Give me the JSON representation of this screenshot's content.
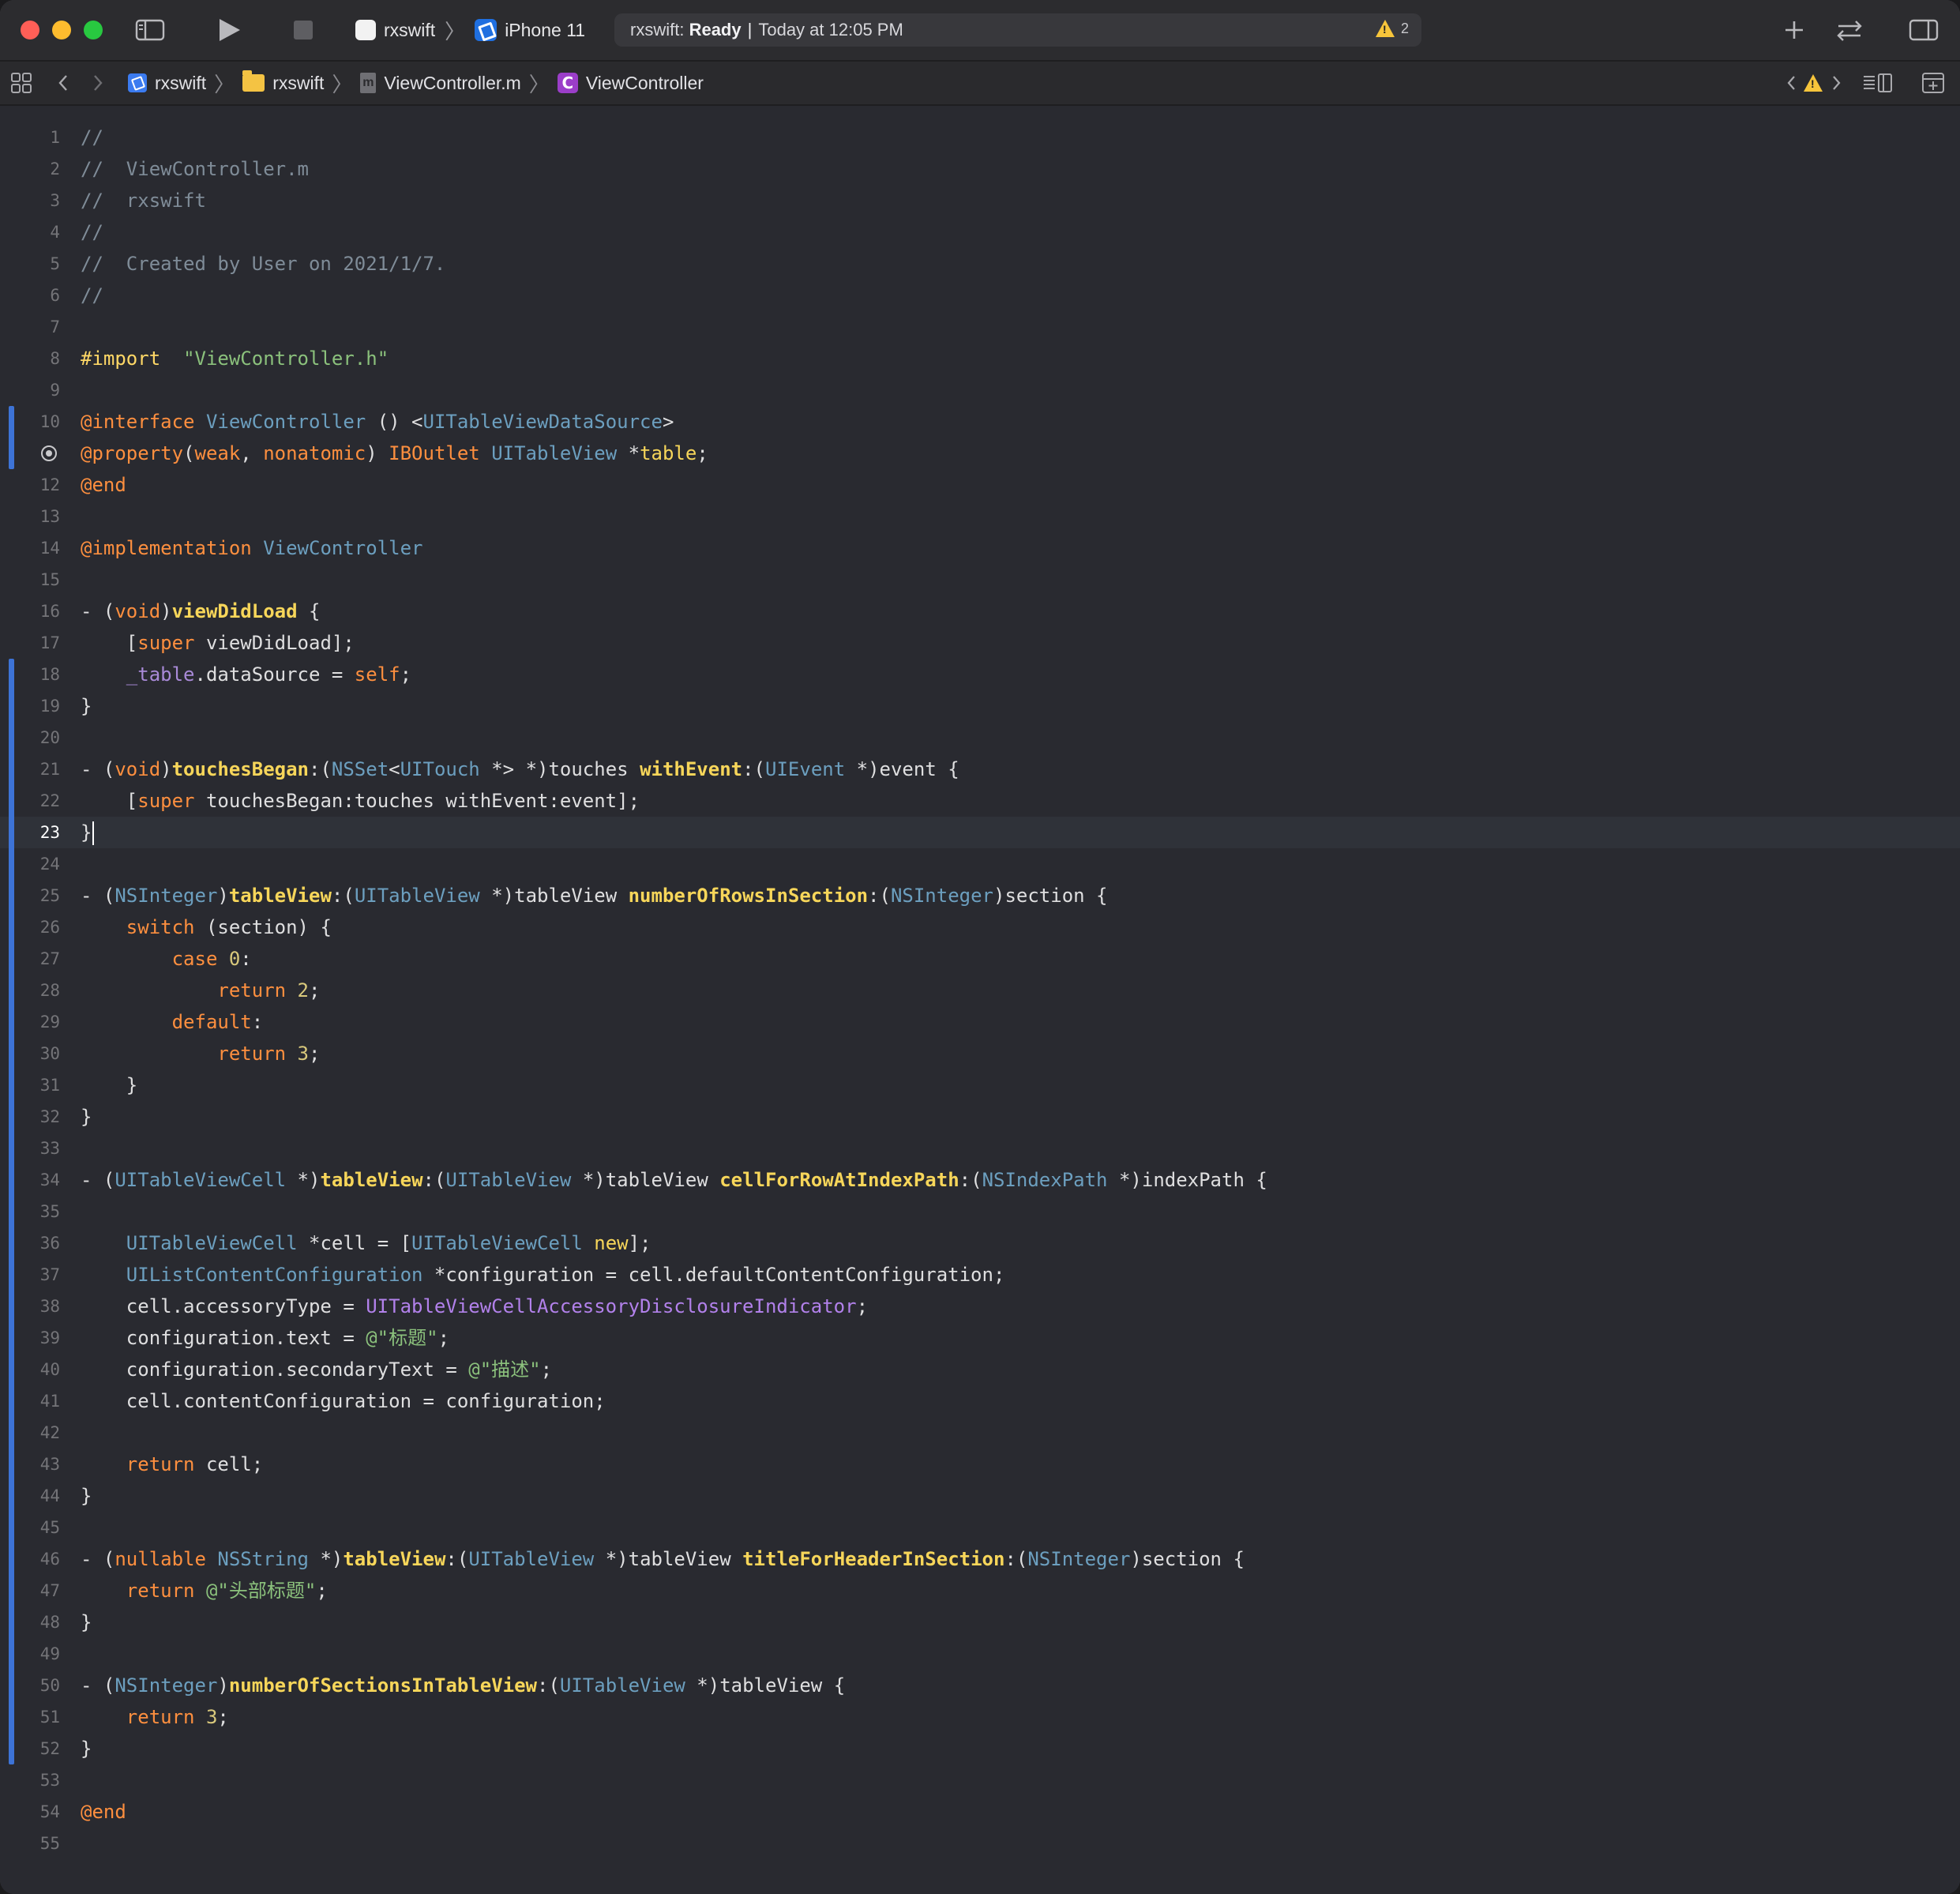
{
  "titlebar": {
    "scheme_project": "rxswift",
    "scheme_device": "iPhone 11",
    "activity_project": "rxswift:",
    "activity_status": "Ready",
    "activity_sep": "|",
    "activity_time": "Today at 12:05 PM",
    "warning_count": "2"
  },
  "jumpbar": {
    "project": "rxswift",
    "group": "rxswift",
    "file": "ViewController.m",
    "symbol": "ViewController"
  },
  "editor": {
    "current_line": 23,
    "changed_ranges": [
      [
        10,
        11
      ],
      [
        18,
        52
      ]
    ],
    "outlet_line": 11,
    "lines": [
      [
        [
          "cm",
          "//"
        ]
      ],
      [
        [
          "cm",
          "//  ViewController.m"
        ]
      ],
      [
        [
          "cm",
          "//  rxswift"
        ]
      ],
      [
        [
          "cm",
          "//"
        ]
      ],
      [
        [
          "cm",
          "//  Created by User on 2021/1/7."
        ]
      ],
      [
        [
          "cm",
          "//"
        ]
      ],
      [],
      [
        [
          "imp",
          "#import"
        ],
        [
          "",
          "  "
        ],
        [
          "str",
          "\"ViewController.h\""
        ]
      ],
      [],
      [
        [
          "ak",
          "@interface"
        ],
        [
          "",
          " "
        ],
        [
          "ty",
          "ViewController"
        ],
        [
          "",
          " () <"
        ],
        [
          "ty",
          "UITableViewDataSource"
        ],
        [
          "",
          ">"
        ]
      ],
      [
        [
          "ak",
          "@property"
        ],
        [
          "",
          "("
        ],
        [
          "ak",
          "weak"
        ],
        [
          "",
          ", "
        ],
        [
          "ak",
          "nonatomic"
        ],
        [
          "",
          ") "
        ],
        [
          "ak",
          "IBOutlet"
        ],
        [
          "",
          " "
        ],
        [
          "ty",
          "UITableView"
        ],
        [
          "",
          " *"
        ],
        [
          "fnd",
          "table"
        ],
        [
          "",
          ";"
        ]
      ],
      [
        [
          "ak",
          "@end"
        ]
      ],
      [],
      [
        [
          "ak",
          "@implementation"
        ],
        [
          "",
          " "
        ],
        [
          "ty",
          "ViewController"
        ]
      ],
      [],
      [
        [
          "",
          "- ("
        ],
        [
          "ak",
          "void"
        ],
        [
          "",
          ")"
        ],
        [
          "fn",
          "viewDidLoad"
        ],
        [
          "",
          " {"
        ]
      ],
      [
        [
          "",
          "    ["
        ],
        [
          "ak",
          "super"
        ],
        [
          "",
          " viewDidLoad];"
        ]
      ],
      [
        [
          "",
          "    "
        ],
        [
          "iv",
          "_table"
        ],
        [
          "",
          ".dataSource = "
        ],
        [
          "ak",
          "self"
        ],
        [
          "",
          ";"
        ]
      ],
      [
        [
          "",
          "}"
        ]
      ],
      [],
      [
        [
          "",
          "- ("
        ],
        [
          "ak",
          "void"
        ],
        [
          "",
          ")"
        ],
        [
          "fn",
          "touchesBegan"
        ],
        [
          "",
          ":("
        ],
        [
          "ty",
          "NSSet"
        ],
        [
          "",
          "<"
        ],
        [
          "ty",
          "UITouch"
        ],
        [
          "",
          " *> *)touches "
        ],
        [
          "fn",
          "withEvent"
        ],
        [
          "",
          ":("
        ],
        [
          "ty",
          "UIEvent"
        ],
        [
          "",
          " *)event {"
        ]
      ],
      [
        [
          "",
          "    ["
        ],
        [
          "ak",
          "super"
        ],
        [
          "",
          " touchesBegan:touches withEvent:event];"
        ]
      ],
      [
        [
          "",
          "}"
        ]
      ],
      [],
      [
        [
          "",
          "- ("
        ],
        [
          "ty",
          "NSInteger"
        ],
        [
          "",
          ")"
        ],
        [
          "fn",
          "tableView"
        ],
        [
          "",
          ":("
        ],
        [
          "ty",
          "UITableView"
        ],
        [
          "",
          " *)tableView "
        ],
        [
          "fn",
          "numberOfRowsInSection"
        ],
        [
          "",
          ":("
        ],
        [
          "ty",
          "NSInteger"
        ],
        [
          "",
          ")section {"
        ]
      ],
      [
        [
          "",
          "    "
        ],
        [
          "ak",
          "switch"
        ],
        [
          "",
          " (section) {"
        ]
      ],
      [
        [
          "",
          "        "
        ],
        [
          "ak",
          "case"
        ],
        [
          "",
          " "
        ],
        [
          "num",
          "0"
        ],
        [
          "",
          ":"
        ]
      ],
      [
        [
          "",
          "            "
        ],
        [
          "ak",
          "return"
        ],
        [
          "",
          " "
        ],
        [
          "num",
          "2"
        ],
        [
          "",
          ";"
        ]
      ],
      [
        [
          "",
          "        "
        ],
        [
          "ak",
          "default"
        ],
        [
          "",
          ":"
        ]
      ],
      [
        [
          "",
          "            "
        ],
        [
          "ak",
          "return"
        ],
        [
          "",
          " "
        ],
        [
          "num",
          "3"
        ],
        [
          "",
          ";"
        ]
      ],
      [
        [
          "",
          "    }"
        ]
      ],
      [
        [
          "",
          "}"
        ]
      ],
      [],
      [
        [
          "",
          "- ("
        ],
        [
          "ty",
          "UITableViewCell"
        ],
        [
          "",
          " *)"
        ],
        [
          "fn",
          "tableView"
        ],
        [
          "",
          ":("
        ],
        [
          "ty",
          "UITableView"
        ],
        [
          "",
          " *)tableView "
        ],
        [
          "fn",
          "cellForRowAtIndexPath"
        ],
        [
          "",
          ":("
        ],
        [
          "ty",
          "NSIndexPath"
        ],
        [
          "",
          " *)indexPath {"
        ]
      ],
      [],
      [
        [
          "",
          "    "
        ],
        [
          "ty",
          "UITableViewCell"
        ],
        [
          "",
          " *cell = ["
        ],
        [
          "ty",
          "UITableViewCell"
        ],
        [
          "",
          " "
        ],
        [
          "fnd",
          "new"
        ],
        [
          "",
          "];"
        ]
      ],
      [
        [
          "",
          "    "
        ],
        [
          "ty",
          "UIListContentConfiguration"
        ],
        [
          "",
          " *configuration = cell.defaultContentConfiguration;"
        ]
      ],
      [
        [
          "",
          "    cell.accessoryType = "
        ],
        [
          "cn",
          "UITableViewCellAccessoryDisclosureIndicator"
        ],
        [
          "",
          ";"
        ]
      ],
      [
        [
          "",
          "    configuration.text = "
        ],
        [
          "str",
          "@\"标题\""
        ],
        [
          "",
          ";"
        ]
      ],
      [
        [
          "",
          "    configuration.secondaryText = "
        ],
        [
          "str",
          "@\"描述\""
        ],
        [
          "",
          ";"
        ]
      ],
      [
        [
          "",
          "    cell.contentConfiguration = configuration;"
        ]
      ],
      [],
      [
        [
          "",
          "    "
        ],
        [
          "ak",
          "return"
        ],
        [
          "",
          " cell;"
        ]
      ],
      [
        [
          "",
          "}"
        ]
      ],
      [],
      [
        [
          "",
          "- ("
        ],
        [
          "ak",
          "nullable"
        ],
        [
          "",
          " "
        ],
        [
          "ty",
          "NSString"
        ],
        [
          "",
          " *)"
        ],
        [
          "fn",
          "tableView"
        ],
        [
          "",
          ":("
        ],
        [
          "ty",
          "UITableView"
        ],
        [
          "",
          " *)tableView "
        ],
        [
          "fn",
          "titleForHeaderInSection"
        ],
        [
          "",
          ":("
        ],
        [
          "ty",
          "NSInteger"
        ],
        [
          "",
          ")section {"
        ]
      ],
      [
        [
          "",
          "    "
        ],
        [
          "ak",
          "return"
        ],
        [
          "",
          " "
        ],
        [
          "str",
          "@\"头部标题\""
        ],
        [
          "",
          ";"
        ]
      ],
      [
        [
          "",
          "}"
        ]
      ],
      [],
      [
        [
          "",
          "- ("
        ],
        [
          "ty",
          "NSInteger"
        ],
        [
          "",
          ")"
        ],
        [
          "fn",
          "numberOfSectionsInTableView"
        ],
        [
          "",
          ":("
        ],
        [
          "ty",
          "UITableView"
        ],
        [
          "",
          " *)tableView {"
        ]
      ],
      [
        [
          "",
          "    "
        ],
        [
          "ak",
          "return"
        ],
        [
          "",
          " "
        ],
        [
          "num",
          "3"
        ],
        [
          "",
          ";"
        ]
      ],
      [
        [
          "",
          "}"
        ]
      ],
      [],
      [
        [
          "ak",
          "@end"
        ]
      ],
      []
    ]
  },
  "icons": {
    "sidebar_toggle": "sidebar-left-icon",
    "run": "play-icon",
    "stop": "stop-icon",
    "library": "plus-icon",
    "code_review": "arrows-swap-icon",
    "inspector": "sidebar-right-icon",
    "related_items": "grid-icon",
    "back": "chevron-left-icon",
    "forward": "chevron-right-icon",
    "issue_prev": "chevron-left-icon",
    "issue_warning": "warning-icon",
    "issue_next": "chevron-right-icon",
    "editor_options": "lines-icon",
    "add_editor": "add-editor-icon"
  }
}
